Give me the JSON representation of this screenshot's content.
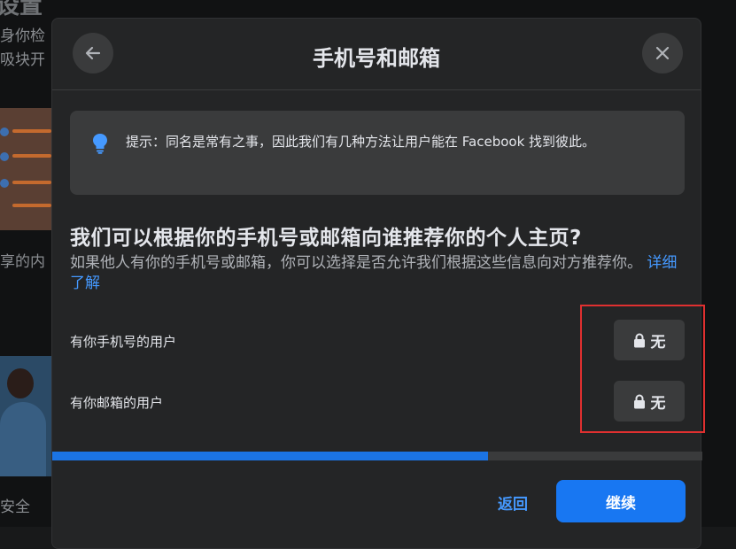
{
  "background": {
    "title": "设置",
    "line1": "身你检",
    "line2": "吸块开",
    "caption1": "享的内",
    "caption2": "安全"
  },
  "dialog": {
    "title": "手机号和邮箱",
    "tip": "提示：同名是常有之事，因此我们有几种方法让用户能在 Facebook 找到彼此。",
    "question": "我们可以根据你的手机号或邮箱向谁推荐你的个人主页?",
    "description": "如果他人有你的手机号或邮箱，你可以选择是否允许我们根据这些信息向对方推荐你。",
    "learn_more": "详细了解",
    "rows": [
      {
        "label": "有你手机号的用户",
        "value": "无"
      },
      {
        "label": "有你邮箱的用户",
        "value": "无"
      }
    ],
    "progress": 0.67,
    "back_label": "返回",
    "continue_label": "继续"
  },
  "colors": {
    "accent": "#1877f2",
    "link": "#4599ff",
    "highlight": "#e03030"
  }
}
